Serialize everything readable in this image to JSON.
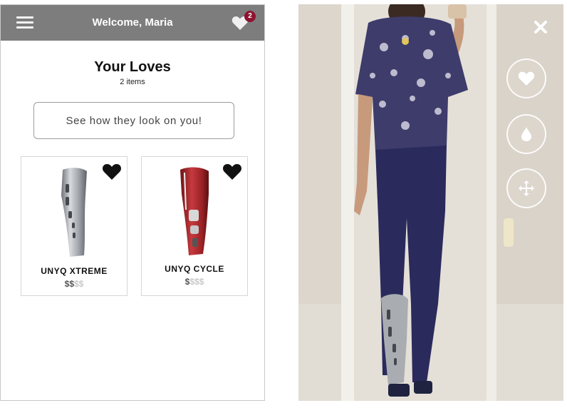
{
  "header": {
    "title": "Welcome, Maria",
    "menu_icon": "hamburger-menu-icon",
    "loves_icon": "heart-icon",
    "loves_badge": "2"
  },
  "page": {
    "title": "Your Loves",
    "item_count": "2 items"
  },
  "cta": {
    "label": "See how they look on you!"
  },
  "products": [
    {
      "name": "UNYQ XTREME",
      "price_active": "$$",
      "price_inactive": "$$",
      "favorite_icon": "heart-icon",
      "color": "#b0b3b8"
    },
    {
      "name": "UNYQ CYCLE",
      "price_active": "$",
      "price_inactive": "$$$",
      "favorite_icon": "heart-icon",
      "color": "#a3262a"
    }
  ],
  "tryon": {
    "close_icon": "close-icon",
    "controls": [
      "heart-icon",
      "drop-icon",
      "move-arrows-icon"
    ]
  },
  "colors": {
    "topbar": "#7d7d7d",
    "badge": "#8e1231",
    "shirt": "#3d3c6b",
    "jeans": "#2a2a5c"
  }
}
